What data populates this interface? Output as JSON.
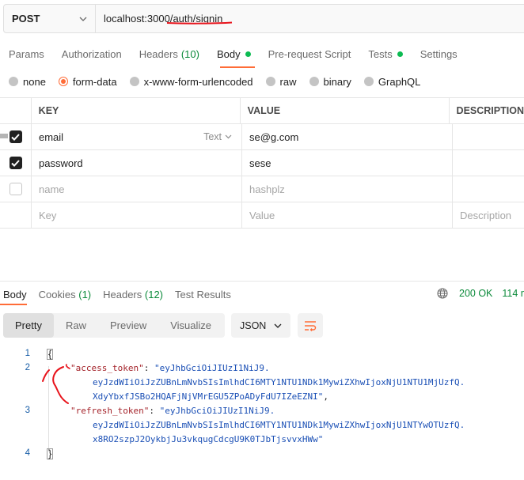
{
  "request": {
    "method": "POST",
    "url": "localhost:3000/auth/signin"
  },
  "req_tabs": [
    {
      "label": "Params"
    },
    {
      "label": "Authorization"
    },
    {
      "label": "Headers",
      "count": "(10)"
    },
    {
      "label": "Body"
    },
    {
      "label": "Pre-request Script"
    },
    {
      "label": "Tests"
    },
    {
      "label": "Settings"
    }
  ],
  "body_types": [
    "none",
    "form-data",
    "x-www-form-urlencoded",
    "raw",
    "binary",
    "GraphQL"
  ],
  "body_type_selected": "form-data",
  "table": {
    "headers": {
      "key": "KEY",
      "value": "VALUE",
      "description": "DESCRIPTION"
    },
    "rows": [
      {
        "key": "email",
        "type": "Text",
        "value": "se@g.com",
        "checked": true
      },
      {
        "key": "password",
        "value": "sese",
        "checked": true
      }
    ],
    "disabled_row": {
      "key": "name",
      "value": "hashplz"
    },
    "empty_row": {
      "key": "Key",
      "value": "Value",
      "description": "Description"
    }
  },
  "response": {
    "tabs": [
      {
        "label": "Body"
      },
      {
        "label": "Cookies",
        "count": "(1)"
      },
      {
        "label": "Headers",
        "count": "(12)"
      },
      {
        "label": "Test Results"
      }
    ],
    "status": "200 OK",
    "time": "114 m",
    "format_buttons": [
      "Pretty",
      "Raw",
      "Preview",
      "Visualize"
    ],
    "format_selected": "Pretty",
    "language": "JSON",
    "code": {
      "line_numbers": [
        "1",
        "2",
        "3",
        "4"
      ],
      "open_brace": "{",
      "close_brace": "}",
      "access_key": "\"access_token\"",
      "access_val_1": "\"eyJhbGciOiJIUzI1NiJ9.",
      "access_val_2": "eyJzdWIiOiJzZUBnLmNvbSIsImlhdCI6MTY1NTU1NDk1MywiZXhwIjoxNjU1NTU1MjUzfQ.",
      "access_val_3": "XdyYbxfJSBo2HQAFjNjVMrEGU5ZPoADyFdU7IZeEZNI\"",
      "refresh_key": "\"refresh_token\"",
      "refresh_val_1": "\"eyJhbGciOiJIUzI1NiJ9.",
      "refresh_val_2": "eyJzdWIiOiJzZUBnLmNvbSIsImlhdCI6MTY1NTU1NDk1MywiZXhwIjoxNjU1NTYwOTUzfQ.",
      "refresh_val_3": "x8RO2szpJ2OykbjJu3vkqugCdcgU9K0TJbTjsvvxHWw\""
    }
  },
  "colors": {
    "accent": "#ff6c37",
    "success": "#0cbb52",
    "annotation": "#e8141c"
  }
}
